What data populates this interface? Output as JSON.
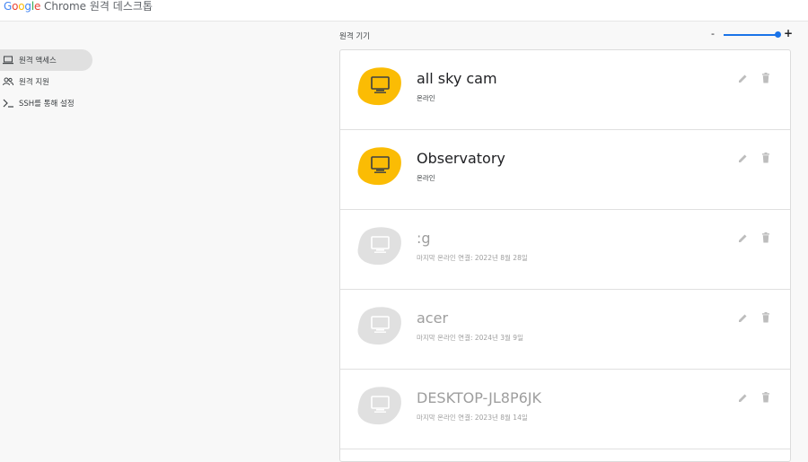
{
  "header": {
    "brand_google": "Google",
    "brand_rest": "Chrome 원격 데스크톱"
  },
  "sidebar": {
    "items": [
      {
        "label": "원격 액세스",
        "icon": "laptop-icon",
        "active": true
      },
      {
        "label": "원격 지원",
        "icon": "people-icon",
        "active": false
      },
      {
        "label": "SSH를 통해 설정",
        "icon": "terminal-icon",
        "active": false
      }
    ]
  },
  "main": {
    "section_label": "원격 기기",
    "zoom": {
      "minus": "-",
      "plus": "+",
      "level": 0.95
    },
    "devices": [
      {
        "name": "all sky cam",
        "status": "온라인",
        "online": true
      },
      {
        "name": "Observatory",
        "status": "온라인",
        "online": true
      },
      {
        "name": ":g",
        "status": "마지막 온라인 연결: 2022년 8월 28일",
        "online": false
      },
      {
        "name": "acer",
        "status": "마지막 온라인 연결: 2024년 3월 9일",
        "online": false
      },
      {
        "name": "DESKTOP-JL8P6JK",
        "status": "마지막 온라인 연결: 2023년 8월 14일",
        "online": false
      }
    ]
  },
  "colors": {
    "online_blob": "#fbbc04",
    "offline_blob": "#e0e0e0",
    "accent": "#1a73e8"
  }
}
